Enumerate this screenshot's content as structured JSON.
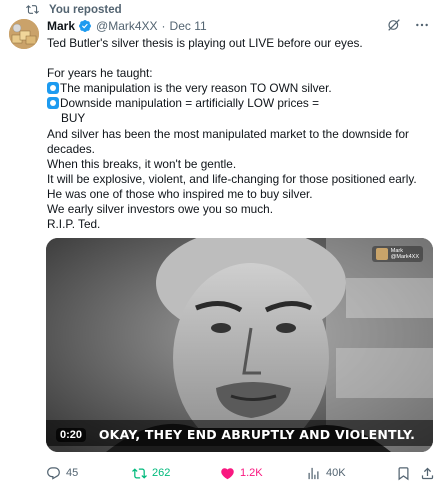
{
  "repost_banner": {
    "label": "You reposted"
  },
  "author": {
    "name": "Mark",
    "handle": "@Mark4XX",
    "separator": "·",
    "date": "Dec 11"
  },
  "tweet": {
    "lines": [
      "Ted Butler's silver thesis is playing out LIVE before our eyes.",
      "",
      "For years he taught:",
      "The manipulation is the very reason TO OWN silver.",
      "Downside manipulation = artificially LOW prices =",
      "BUY",
      "And silver has been the most manipulated market to the downside for",
      "decades.",
      "When this breaks, it won't be gentle.",
      "It will be explosive, violent, and life-changing for those positioned early.",
      "He was one of those who inspired me to buy silver.",
      "We early silver investors owe you so much.",
      "R.I.P. Ted."
    ]
  },
  "media": {
    "caption": "OKAY, THEY END ABRUPTLY AND VIOLENTLY.",
    "duration": "0:20",
    "watermark_name": "Mark",
    "watermark_handle": "@Mark4XX"
  },
  "actions": {
    "replies": "45",
    "reposts": "262",
    "likes": "1.2K",
    "views": "40K"
  },
  "colors": {
    "accent": "#1d9bf0",
    "repost": "#00ba7c",
    "like": "#f91880",
    "muted": "#536471"
  },
  "icons": [
    "repost-icon",
    "verified-badge-icon",
    "grok-icon",
    "more-icon",
    "reply-icon",
    "heart-icon",
    "views-icon",
    "bookmark-icon",
    "share-icon"
  ]
}
